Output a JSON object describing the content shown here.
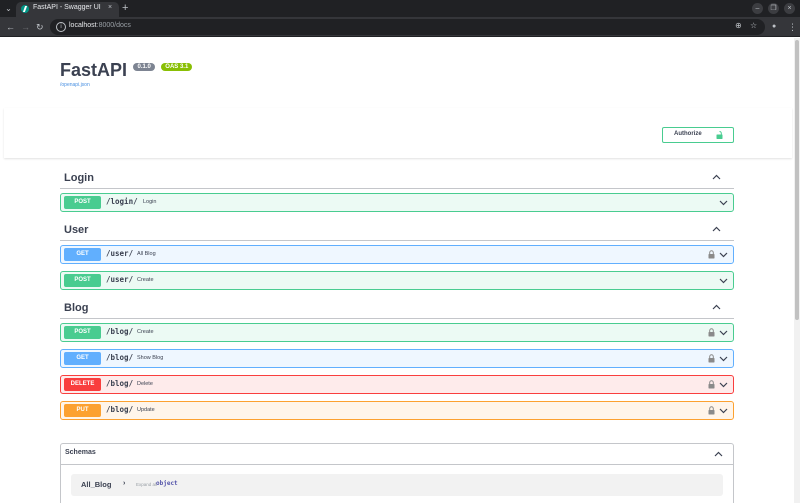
{
  "browser": {
    "tab_title": "FastAPI - Swagger UI",
    "tab_close": "×",
    "new_tab": "+",
    "url_host": "localhost",
    "url_path": ":8000/docs"
  },
  "icons": {
    "tab_menu": "⌄",
    "back": "←",
    "forward": "→",
    "reload": "↻",
    "info": "i",
    "zoom": "⊕",
    "bookmark": "☆",
    "profile": "●",
    "menu": "⋮",
    "minimize": "–",
    "restore": "❐",
    "close": "×"
  },
  "info": {
    "title": "FastAPI",
    "version": "0.1.0",
    "oas": "OAS 3.1",
    "openapi_link": "/openapi.json"
  },
  "authorize": {
    "label": "Authorize"
  },
  "tags": [
    {
      "name": "Login",
      "operations": [
        {
          "method": "POST",
          "path": "/login/",
          "summary": "Login",
          "locked": false
        }
      ]
    },
    {
      "name": "User",
      "operations": [
        {
          "method": "GET",
          "path": "/user/",
          "summary": "All Blog",
          "locked": true
        },
        {
          "method": "POST",
          "path": "/user/",
          "summary": "Create",
          "locked": false
        }
      ]
    },
    {
      "name": "Blog",
      "operations": [
        {
          "method": "POST",
          "path": "/blog/",
          "summary": "Create",
          "locked": true
        },
        {
          "method": "GET",
          "path": "/blog/",
          "summary": "Show Blog",
          "locked": true
        },
        {
          "method": "DELETE",
          "path": "/blog/",
          "summary": "Delete",
          "locked": true
        },
        {
          "method": "PUT",
          "path": "/blog/",
          "summary": "Update",
          "locked": true
        }
      ]
    }
  ],
  "schemas": {
    "title": "Schemas",
    "models": [
      {
        "name": "All_Blog",
        "toggle": "›",
        "expand_label": "Expand all",
        "type": "object"
      }
    ]
  },
  "colors": {
    "post": "#49cc90",
    "get": "#61affe",
    "delete": "#f93e3e",
    "put": "#fca130",
    "text": "#3b4151"
  }
}
